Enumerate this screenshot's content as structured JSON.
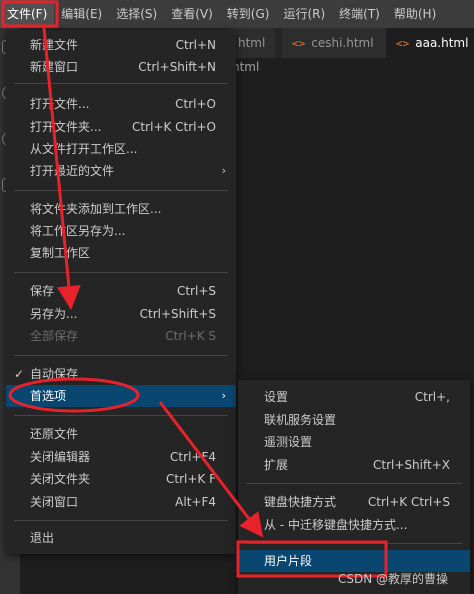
{
  "menubar": [
    "文件(F)",
    "编辑(E)",
    "选择(S)",
    "查看(V)",
    "转到(G)",
    "运行(R)",
    "终端(T)",
    "帮助(H)"
  ],
  "tabs": [
    {
      "label": "html"
    },
    {
      "label": "ceshi.html"
    },
    {
      "label": "aaa.html",
      "close": "×"
    }
  ],
  "breadcrumb": "html",
  "file_menu": {
    "items": [
      {
        "label": "新建文件",
        "shortcut": "Ctrl+N"
      },
      {
        "label": "新建窗口",
        "shortcut": "Ctrl+Shift+N"
      },
      {
        "label": "打开文件...",
        "shortcut": "Ctrl+O"
      },
      {
        "label": "打开文件夹...",
        "shortcut": "Ctrl+K Ctrl+O"
      },
      {
        "label": "从文件打开工作区..."
      },
      {
        "label": "打开最近的文件",
        "arrow": "›"
      },
      {
        "label": "将文件夹添加到工作区..."
      },
      {
        "label": "将工作区另存为..."
      },
      {
        "label": "复制工作区"
      },
      {
        "label": "保存",
        "shortcut": "Ctrl+S"
      },
      {
        "label": "另存为...",
        "shortcut": "Ctrl+Shift+S"
      },
      {
        "label": "全部保存",
        "shortcut": "Ctrl+K S"
      },
      {
        "label": "自动保存",
        "check": "✓"
      },
      {
        "label": "首选项",
        "arrow": "›"
      },
      {
        "label": "还原文件"
      },
      {
        "label": "关闭编辑器",
        "shortcut": "Ctrl+F4"
      },
      {
        "label": "关闭文件夹",
        "shortcut": "Ctrl+K F"
      },
      {
        "label": "关闭窗口",
        "shortcut": "Alt+F4"
      },
      {
        "label": "退出"
      }
    ]
  },
  "preferences_menu": {
    "items": [
      {
        "label": "设置",
        "shortcut": "Ctrl+,"
      },
      {
        "label": "联机服务设置"
      },
      {
        "label": "遥测设置"
      },
      {
        "label": "扩展",
        "shortcut": "Ctrl+Shift+X"
      },
      {
        "label": "键盘快捷方式",
        "shortcut": "Ctrl+K Ctrl+S"
      },
      {
        "label": "从 - 中迁移键盘快捷方式..."
      },
      {
        "label": "用户片段"
      }
    ]
  },
  "watermark": "CSDN @教厚的曹操",
  "colors": {
    "menu_bg": "#252526",
    "highlight": "#094771",
    "annotation": "#e8222a"
  }
}
